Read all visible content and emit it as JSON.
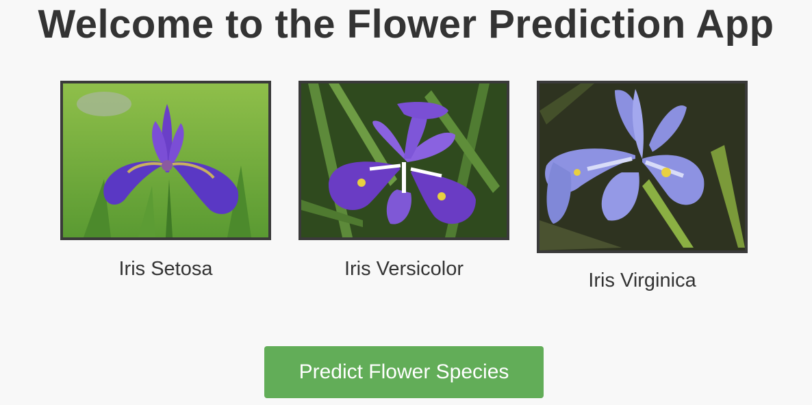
{
  "header": {
    "title": "Welcome to the Flower Prediction App"
  },
  "flowers": [
    {
      "label": "Iris Setosa",
      "image": "iris-setosa-photo"
    },
    {
      "label": "Iris Versicolor",
      "image": "iris-versicolor-photo"
    },
    {
      "label": "Iris Virginica",
      "image": "iris-virginica-photo"
    }
  ],
  "actions": {
    "predict_label": "Predict Flower Species"
  },
  "colors": {
    "background": "#f8f8f8",
    "text": "#333333",
    "button": "#62ad58",
    "frame": "#3a3a3a"
  }
}
